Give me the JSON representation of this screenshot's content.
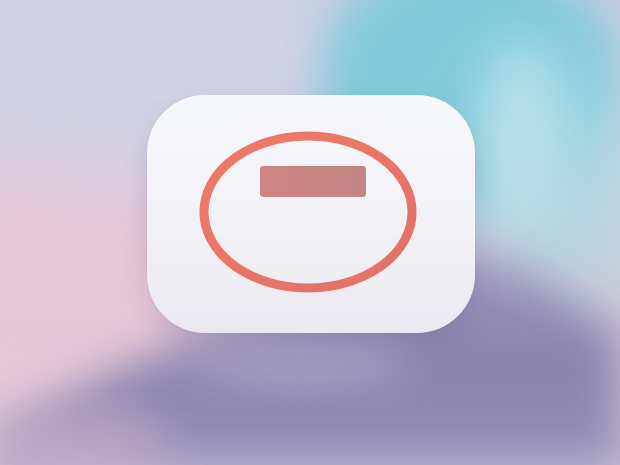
{
  "colors": {
    "sky_blue": "#7ec9da",
    "sky_lavender": "#cfd0e3",
    "sky_pink": "#e6c6d4",
    "mountain": "#7f7aa6",
    "icon_face": "#f4f4f8",
    "ring": "#ea7565",
    "bar": "#c98383"
  },
  "icons": {
    "app": "ellipse-with-bar-app-icon",
    "background": "blurred-mountain-wallpaper"
  }
}
